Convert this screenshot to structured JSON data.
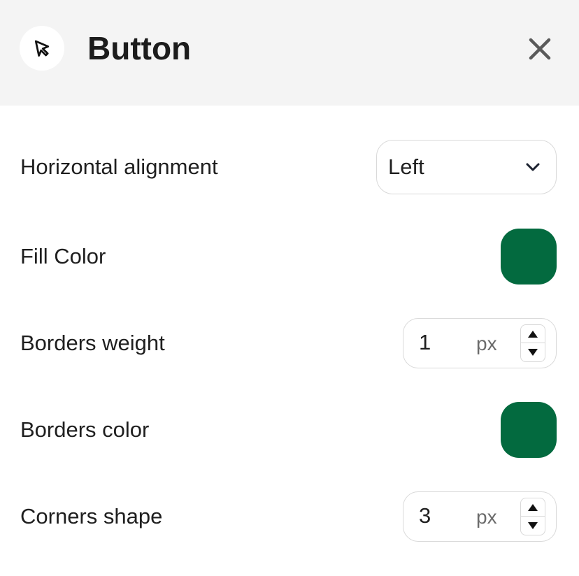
{
  "header": {
    "title": "Button",
    "icon": "cursor-arrow-icon",
    "close_icon": "close-icon"
  },
  "rows": {
    "horizontal_alignment": {
      "label": "Horizontal alignment",
      "value": "Left",
      "options": [
        "Left"
      ]
    },
    "fill_color": {
      "label": "Fill Color",
      "color": "#036a3f"
    },
    "borders_weight": {
      "label": "Borders weight",
      "value": "1",
      "unit": "px"
    },
    "borders_color": {
      "label": "Borders color",
      "color": "#036a3f"
    },
    "corners_shape": {
      "label": "Corners shape",
      "value": "3",
      "unit": "px"
    }
  },
  "colors": {
    "header_bg": "#f4f4f4",
    "border": "#d9d9d9",
    "accent_green": "#036a3f"
  }
}
